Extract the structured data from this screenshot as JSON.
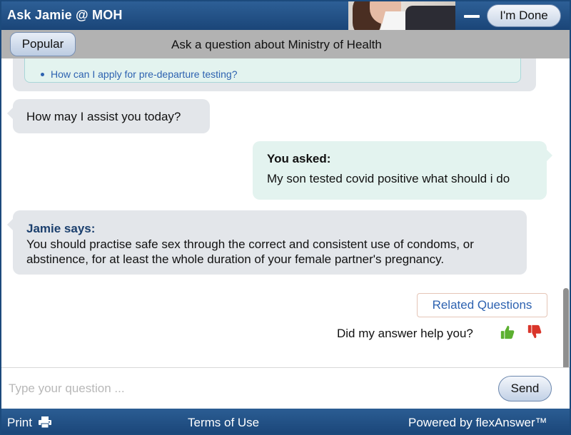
{
  "header": {
    "title": "Ask Jamie @ MOH",
    "done_label": "I'm Done"
  },
  "subheader": {
    "popular_label": "Popular",
    "title": "Ask a question about Ministry of Health"
  },
  "chat": {
    "popular_question": "How can I apply for pre-departure testing?",
    "greeting": "How may I assist you today?",
    "user_label": "You asked:",
    "user_question": "My son tested covid positive what should i do",
    "bot_label": "Jamie says:",
    "bot_answer": "You should practise safe sex through the correct and consistent use of condoms, or abstinence, for at least the whole duration of your female partner's pregnancy.",
    "related_label": "Related Questions",
    "feedback_prompt": "Did my answer help you?",
    "thumb_up_icon": "thumbs-up-icon",
    "thumb_down_icon": "thumbs-down-icon"
  },
  "input": {
    "placeholder": "Type your question ...",
    "value": "",
    "send_label": "Send"
  },
  "footer": {
    "print_label": "Print",
    "print_icon": "printer-icon",
    "terms_label": "Terms of Use",
    "powered_by": "Powered by flexAnswer™"
  },
  "colors": {
    "header_blue": "#1f4c80",
    "bubble_grey": "#e3e6ea",
    "bubble_mint": "#e3f3ef",
    "link_blue": "#2d62b0",
    "thumb_up_green": "#5cb030",
    "thumb_down_red": "#d9352a"
  }
}
